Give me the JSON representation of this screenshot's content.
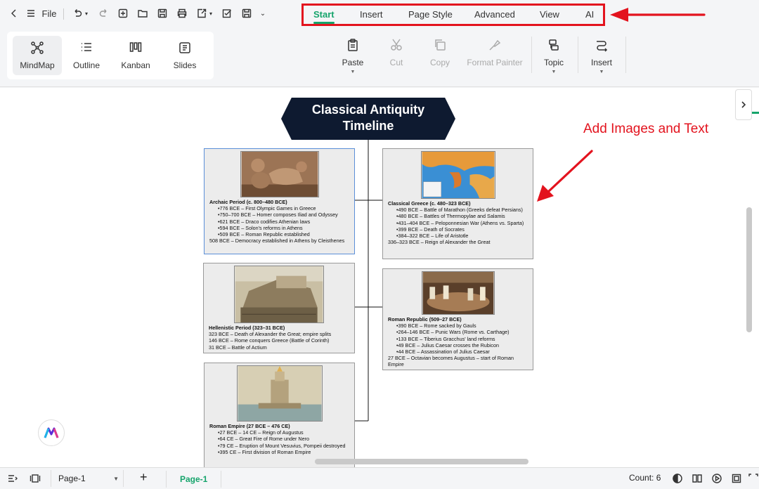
{
  "topbar": {
    "file_label": "File",
    "menu_tabs": [
      "Start",
      "Insert",
      "Page Style",
      "Advanced",
      "View",
      "AI"
    ],
    "active_tab": "Start"
  },
  "views": {
    "items": [
      "MindMap",
      "Outline",
      "Kanban",
      "Slides"
    ],
    "active": "MindMap"
  },
  "toolbar": {
    "paste": "Paste",
    "cut": "Cut",
    "copy": "Copy",
    "format_painter": "Format Painter",
    "topic": "Topic",
    "insert": "Insert"
  },
  "mindmap": {
    "root_title": "Classical Antiquity Timeline",
    "annotation": "Add Images and Text",
    "nodes": {
      "archaic": {
        "title": "Archaic Period (c. 800–480 BCE)",
        "bullets": [
          "776 BCE – First Olympic Games in Greece",
          "750–700 BCE – Homer composes Iliad and Odyssey",
          "621 BCE – Draco codifies Athenian laws",
          "594 BCE – Solon's reforms in Athens",
          "509 BCE – Roman Republic established"
        ],
        "plain": [
          "508 BCE – Democracy established in Athens by Cleisthenes"
        ]
      },
      "hellenistic": {
        "title": "Hellenistic Period (323–31 BCE)",
        "plain": [
          "323 BCE – Death of Alexander the Great; empire splits",
          "146 BCE – Rome conquers Greece (Battle of Corinth)",
          "31 BCE – Battle of Actium"
        ]
      },
      "empire": {
        "title": "Roman Empire (27 BCE – 476 CE)",
        "bullets": [
          "27 BCE – 14 CE – Reign of Augustus",
          "64 CE – Great Fire of Rome under Nero",
          "79 CE – Eruption of Mount Vesuvius, Pompeii destroyed",
          "395 CE – First division of Roman Empire"
        ]
      },
      "classical": {
        "title": "Classical Greece (c. 480–323 BCE)",
        "bullets": [
          "490 BCE – Battle of Marathon (Greeks defeat Persians)",
          "480 BCE – Battles of Thermopylae and Salamis",
          "431–404 BCE – Peloponnesian War (Athens vs. Sparta)",
          "399 BCE – Death of Socrates",
          "384–322 BCE – Life of Aristotle"
        ],
        "plain": [
          "336–323 BCE – Reign of Alexander the Great"
        ]
      },
      "republic": {
        "title": "Roman Republic (509–27 BCE)",
        "bullets": [
          "390 BCE – Rome sacked by Gauls",
          "264–146 BCE – Punic Wars (Rome vs. Carthage)",
          "133 BCE – Tiberius Gracchus' land reforms",
          "49 BCE – Julius Caesar crosses the Rubicon",
          "44 BCE – Assassination of Julius Caesar"
        ],
        "plain": [
          "27 BCE – Octavian becomes Augustus – start of Roman Empire"
        ]
      }
    }
  },
  "statusbar": {
    "page_select": "Page-1",
    "page_tab": "Page-1",
    "count": "Count: 6"
  },
  "colors": {
    "accent": "#15a46b",
    "highlight_red": "#e3131e",
    "root_fill": "#0e1a30"
  }
}
